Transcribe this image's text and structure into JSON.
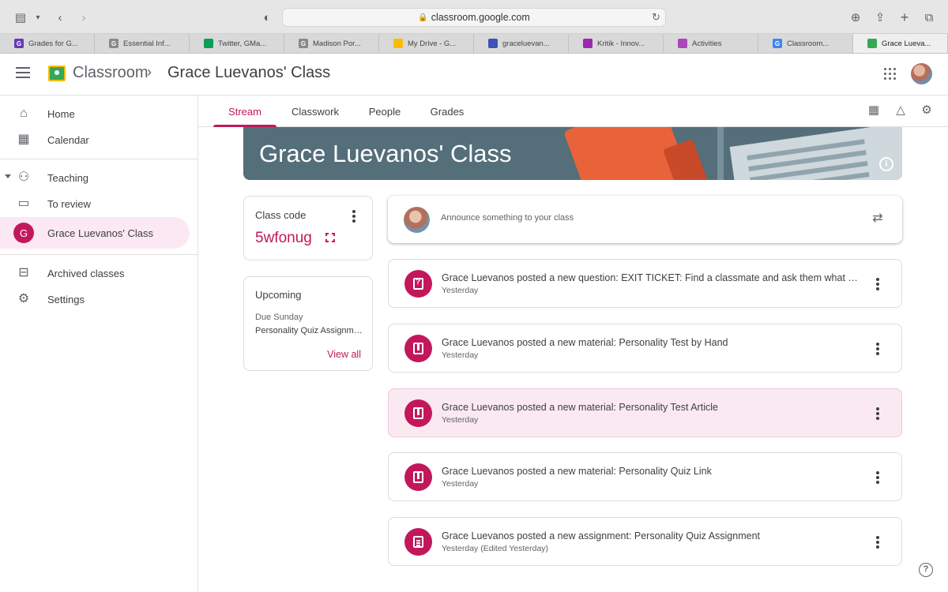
{
  "browser": {
    "url": "classroom.google.com",
    "tabs": [
      {
        "label": "Grades for G...",
        "color": "#673ab7",
        "glyph": "G",
        "active": false
      },
      {
        "label": "Essential Inf...",
        "color": "#8a8a8a",
        "glyph": "G",
        "active": false
      },
      {
        "label": "Twitter, GMa...",
        "color": "#0f9d58",
        "glyph": "",
        "active": false
      },
      {
        "label": "Madison Por...",
        "color": "#8a8a8a",
        "glyph": "G",
        "active": false
      },
      {
        "label": "My Drive - G...",
        "color": "#fbbc04",
        "glyph": "",
        "active": false
      },
      {
        "label": "graceluevan...",
        "color": "#3f51b5",
        "glyph": "",
        "active": false
      },
      {
        "label": "Kritik - Innov...",
        "color": "#9c27b0",
        "glyph": "",
        "active": false
      },
      {
        "label": "Activities",
        "color": "#ab47bc",
        "glyph": "",
        "active": false
      },
      {
        "label": "Classroom...",
        "color": "#4285f4",
        "glyph": "G",
        "active": false
      },
      {
        "label": "Grace Luevа...",
        "color": "#34a853",
        "glyph": "",
        "active": true
      }
    ]
  },
  "header": {
    "app_title": "Classroom",
    "breadcrumb_class": "Grace Luevanos' Class"
  },
  "sidebar": {
    "items": [
      {
        "label": "Home",
        "icon": "home-icon"
      },
      {
        "label": "Calendar",
        "icon": "calendar-icon"
      },
      {
        "label": "Teaching",
        "icon": "teaching-icon"
      },
      {
        "label": "To review",
        "icon": "to-review-icon"
      },
      {
        "label": "Grace Luevanos' Class",
        "initial": "G"
      },
      {
        "label": "Archived classes",
        "icon": "archive-icon"
      },
      {
        "label": "Settings",
        "icon": "gear-icon"
      }
    ]
  },
  "class_tabs": [
    "Stream",
    "Classwork",
    "People",
    "Grades"
  ],
  "banner": {
    "title": "Grace Luevanos' Class"
  },
  "class_code": {
    "label": "Class code",
    "value": "5wfonug"
  },
  "upcoming": {
    "title": "Upcoming",
    "due": "Due Sunday",
    "item": "Personality Quiz Assignment",
    "view_all": "View all"
  },
  "announce": {
    "placeholder": "Announce something to your class"
  },
  "posts": [
    {
      "title": "Grace Luevanos posted a new question: EXIT TICKET: Find a classmate and ask them what could be improved",
      "time": "Yesterday",
      "kind": "question"
    },
    {
      "title": "Grace Luevanos posted a new material: Personality Test by Hand",
      "time": "Yesterday",
      "kind": "material"
    },
    {
      "title": "Grace Luevanos posted a new material: Personality Test Article",
      "time": "Yesterday",
      "kind": "material"
    },
    {
      "title": "Grace Luevanos posted a new material: Personality Quiz Link",
      "time": "Yesterday",
      "kind": "material"
    },
    {
      "title": "Grace Luevanos posted a new assignment: Personality Quiz Assignment",
      "time": "Yesterday (Edited Yesterday)",
      "kind": "assignment"
    }
  ],
  "colors": {
    "accent": "#c2185b",
    "banner": "#546e7a",
    "selected_bg": "#fce8f3"
  }
}
